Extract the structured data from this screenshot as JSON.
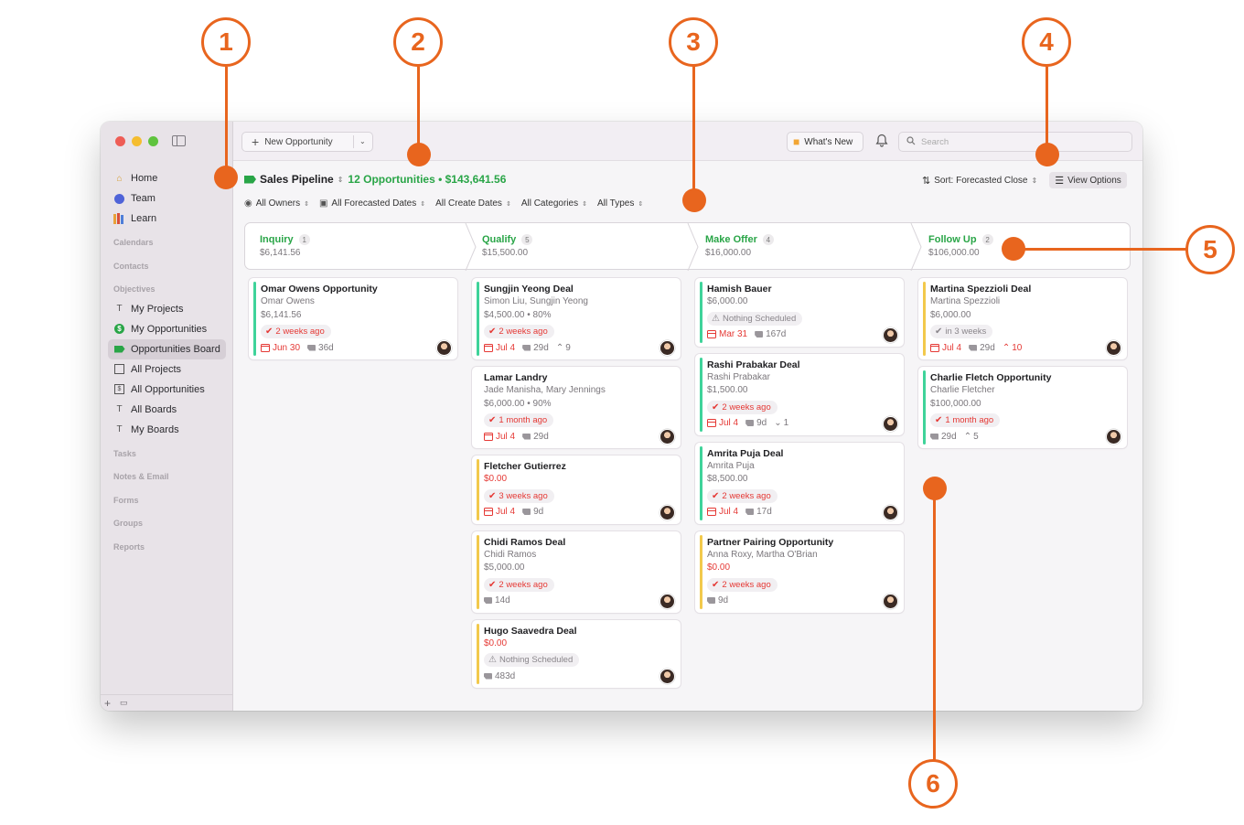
{
  "callouts": [
    "1",
    "2",
    "3",
    "4",
    "5",
    "6"
  ],
  "colors": {
    "accent": "#e8651e",
    "green": "#29a547",
    "red": "#e53935",
    "card_bar_green": "#3fd39a",
    "card_bar_yellow": "#f2c94c"
  },
  "toolbar": {
    "new_label": "New Opportunity",
    "whats_new": "What's New",
    "search_placeholder": "Search"
  },
  "sidebar": {
    "items_top": [
      {
        "label": "Home",
        "icon": "home-icon"
      },
      {
        "label": "Team",
        "icon": "team-icon"
      },
      {
        "label": "Learn",
        "icon": "books-icon"
      }
    ],
    "sections": {
      "calendars": "Calendars",
      "contacts": "Contacts",
      "objectives": "Objectives",
      "tasks": "Tasks",
      "notes": "Notes & Email",
      "forms": "Forms",
      "groups": "Groups",
      "reports": "Reports"
    },
    "objectives": [
      {
        "label": "My Projects",
        "icon": "hammer-icon"
      },
      {
        "label": "My Opportunities",
        "icon": "dollar-icon"
      },
      {
        "label": "Opportunities Board",
        "icon": "tag-icon"
      },
      {
        "label": "All Projects",
        "icon": "board-icon"
      },
      {
        "label": "All Opportunities",
        "icon": "board-dollar-icon"
      },
      {
        "label": "All Boards",
        "icon": "boards-icon"
      },
      {
        "label": "My Boards",
        "icon": "boards-icon"
      }
    ]
  },
  "header": {
    "pipeline": "Sales Pipeline",
    "summary": "12 Opportunities • $143,641.56",
    "sort": "Sort: Forecasted Close",
    "view_options": "View Options"
  },
  "filters": [
    "All Owners",
    "All Forecasted Dates",
    "All Create Dates",
    "All Categories",
    "All Types"
  ],
  "stages": [
    {
      "name": "Inquiry",
      "count": "1",
      "amount": "$6,141.56"
    },
    {
      "name": "Qualify",
      "count": "5",
      "amount": "$15,500.00"
    },
    {
      "name": "Make Offer",
      "count": "4",
      "amount": "$16,000.00"
    },
    {
      "name": "Follow Up",
      "count": "2",
      "amount": "$106,000.00"
    }
  ],
  "columns": [
    [
      {
        "title": "Omar Owens Opportunity",
        "contact": "Omar Owens",
        "value": "$6,141.56",
        "status": "2 weeks ago",
        "date": "Jun 30",
        "age": "36d"
      }
    ],
    [
      {
        "title": "Sungjin Yeong Deal",
        "contact": "Simon Liu, Sungjin Yeong",
        "value": "$4,500.00 • 80%",
        "status": "2 weeks ago",
        "date": "Jul 4",
        "age": "29d",
        "extra": "9"
      },
      {
        "title": "Lamar Landry",
        "contact": "Jade Manisha, Mary Jennings",
        "value": "$6,000.00 • 90%",
        "status": "1 month ago",
        "date": "Jul 4",
        "age": "29d"
      },
      {
        "title": "Fletcher Gutierrez",
        "value": "$0.00",
        "status": "3 weeks ago",
        "date": "Jul 4",
        "age": "9d"
      },
      {
        "title": "Chidi Ramos Deal",
        "contact": "Chidi Ramos",
        "value": "$5,000.00",
        "status": "2 weeks ago",
        "age": "14d"
      },
      {
        "title": "Hugo Saavedra Deal",
        "value": "$0.00",
        "status": "Nothing Scheduled",
        "age": "483d"
      }
    ],
    [
      {
        "title": "Hamish Bauer",
        "value": "$6,000.00",
        "status": "Nothing Scheduled",
        "date": "Mar 31",
        "age": "167d"
      },
      {
        "title": "Rashi Prabakar Deal",
        "contact": "Rashi Prabakar",
        "value": "$1,500.00",
        "status": "2 weeks ago",
        "date": "Jul 4",
        "age": "9d",
        "extra": "1"
      },
      {
        "title": "Amrita Puja Deal",
        "contact": "Amrita Puja",
        "value": "$8,500.00",
        "status": "2 weeks ago",
        "date": "Jul 4",
        "age": "17d"
      },
      {
        "title": "Partner Pairing Opportunity",
        "contact": "Anna Roxy, Martha O'Brian",
        "value": "$0.00",
        "status": "2 weeks ago",
        "age": "9d"
      }
    ],
    [
      {
        "title": "Martina Spezzioli Deal",
        "contact": "Martina Spezzioli",
        "value": "$6,000.00",
        "status": "in 3 weeks",
        "date": "Jul 4",
        "age": "29d",
        "extra": "10"
      },
      {
        "title": "Charlie Fletch Opportunity",
        "contact": "Charlie Fletcher",
        "value": "$100,000.00",
        "status": "1 month ago",
        "age": "29d",
        "extra": "5"
      }
    ]
  ]
}
